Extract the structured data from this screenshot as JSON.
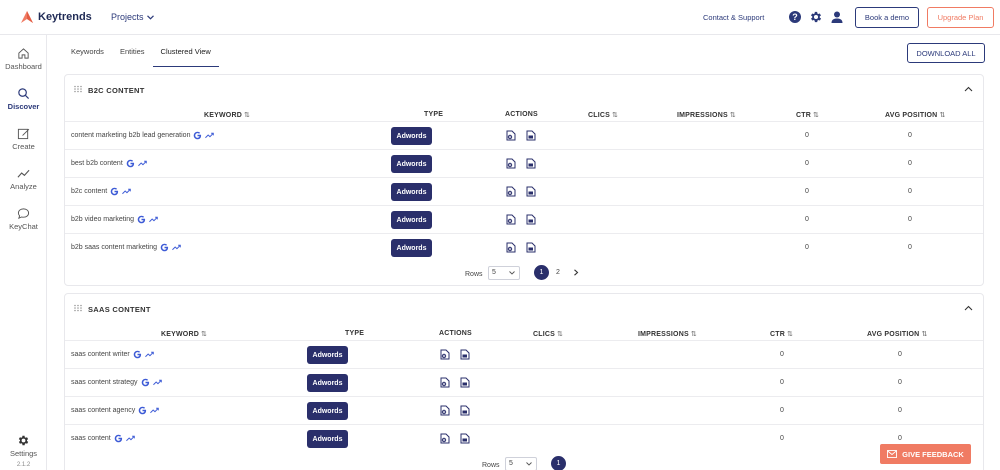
{
  "header": {
    "brand": "Keytrends",
    "projects_label": "Projects",
    "contact_label": "Contact & Support",
    "help_glyph": "?",
    "demo_label": "Book a demo",
    "upgrade_label": "Upgrade Plan",
    "brand_color": "#f07b63",
    "primary_color": "#2c3a7a"
  },
  "sidebar": {
    "items": [
      {
        "label": "Dashboard",
        "icon": "home-icon"
      },
      {
        "label": "Discover",
        "icon": "search-icon",
        "active": true
      },
      {
        "label": "Create",
        "icon": "edit-icon"
      },
      {
        "label": "Analyze",
        "icon": "chart-icon"
      },
      {
        "label": "KeyChat",
        "icon": "chat-icon"
      }
    ],
    "settings_label": "Settings",
    "version": "2.1.2"
  },
  "tabs": [
    {
      "label": "Keywords"
    },
    {
      "label": "Entities"
    },
    {
      "label": "Clustered View",
      "active": true
    }
  ],
  "download_label": "DOWNLOAD ALL",
  "columns": {
    "keyword": "KEYWORD",
    "type": "TYPE",
    "actions": "ACTIONS",
    "clics": "CLICS",
    "impressions": "IMPRESSIONS",
    "ctr": "CTR",
    "avg_position": "AVG POSITION",
    "sort_glyph": "⇅"
  },
  "clusters": [
    {
      "title": "B2C CONTENT",
      "rows": [
        {
          "keyword": "content marketing b2b lead generation",
          "type": "Adwords",
          "ctr": "0",
          "avg_position": "0"
        },
        {
          "keyword": "best b2b content",
          "type": "Adwords",
          "ctr": "0",
          "avg_position": "0"
        },
        {
          "keyword": "b2c content",
          "type": "Adwords",
          "ctr": "0",
          "avg_position": "0"
        },
        {
          "keyword": "b2b video marketing",
          "type": "Adwords",
          "ctr": "0",
          "avg_position": "0"
        },
        {
          "keyword": "b2b saas content marketing",
          "type": "Adwords",
          "ctr": "0",
          "avg_position": "0"
        }
      ],
      "pager": {
        "rows_label": "Rows",
        "rows_value": "5",
        "pages": [
          "1",
          "2"
        ],
        "current": "1"
      }
    },
    {
      "title": "SAAS CONTENT",
      "rows": [
        {
          "keyword": "saas content writer",
          "type": "Adwords",
          "ctr": "0",
          "avg_position": "0"
        },
        {
          "keyword": "saas content strategy",
          "type": "Adwords",
          "ctr": "0",
          "avg_position": "0"
        },
        {
          "keyword": "saas content agency",
          "type": "Adwords",
          "ctr": "0",
          "avg_position": "0"
        },
        {
          "keyword": "saas content",
          "type": "Adwords",
          "ctr": "0",
          "avg_position": "0"
        }
      ],
      "pager": {
        "rows_label": "Rows",
        "rows_value": "5",
        "pages": [
          "1"
        ],
        "current": "1"
      }
    }
  ],
  "feedback_label": "GIVE FEEDBACK"
}
